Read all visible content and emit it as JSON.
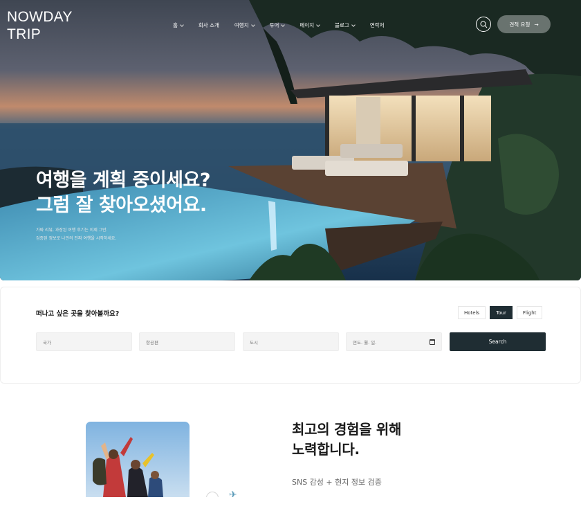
{
  "brand": {
    "line1": "NOWDAY",
    "line2": "TRIP"
  },
  "nav": {
    "items": [
      {
        "label": "홈",
        "has_dropdown": true
      },
      {
        "label": "회사 소개",
        "has_dropdown": false
      },
      {
        "label": "여행지",
        "has_dropdown": true
      },
      {
        "label": "투어",
        "has_dropdown": true
      },
      {
        "label": "페이지",
        "has_dropdown": true
      },
      {
        "label": "블로그",
        "has_dropdown": true
      },
      {
        "label": "연락처",
        "has_dropdown": false
      }
    ],
    "search_icon": "search-icon",
    "quote_button": {
      "label": "견적 요청",
      "icon": "arrow-right-icon"
    }
  },
  "hero": {
    "title_line1": "여행을 계획 중이세요?",
    "title_line2": "그럼 잘 찾아오셨어요.",
    "sub_line1": "가짜 리뷰, 과장된 여행 후기는 이제 그만.",
    "sub_line2": "검증된 정보로 나만의 진짜 여행을 시작하세요."
  },
  "search": {
    "title": "떠나고 싶은 곳을 찾아볼까요?",
    "tabs": [
      {
        "label": "Hotels",
        "active": false
      },
      {
        "label": "Tour",
        "active": true
      },
      {
        "label": "Flight",
        "active": false
      }
    ],
    "fields": {
      "country": "국가",
      "airline": "항공편",
      "city": "도시",
      "date": "연도. 월. 일."
    },
    "submit_label": "Search",
    "accent_color": "#1f2d33"
  },
  "experience": {
    "title_line1": "최고의 경험을 위해",
    "title_line2": "노력합니다.",
    "subtitle": "SNS 감성 + 현지 정보 검증",
    "plane_icon": "airplane-icon"
  }
}
